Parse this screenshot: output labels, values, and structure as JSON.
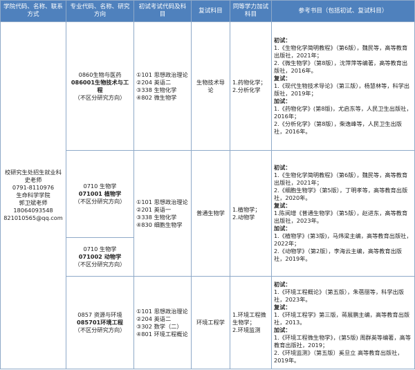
{
  "headers": [
    "学院代码、名称、联系方式",
    "专业代码、名称、研究方向",
    "初试考试代码及科目",
    "复试科目",
    "同等学力加试科目",
    "参考书目（包括初试、复试科目）"
  ],
  "contact": {
    "line1": "校研究生处招生就业科",
    "line2": "史老师",
    "line3": "0791-8110976",
    "line4": "生命科学学院",
    "line5": "郭卫斌老师",
    "line6": "18064093548",
    "line7": "821010565@qq.com"
  },
  "rows": [
    {
      "major_category": "0860生物与医药",
      "major_code_name": "086001生物技术与工程",
      "direction": "（不区分研究方向）",
      "exams": [
        "①101 思想政治理论",
        "②204 英语二",
        "③338 生物化学",
        "④802 微生物学"
      ],
      "retest": "生物技术导论",
      "equiv": [
        "1.药物化学；",
        "2.分析化学"
      ],
      "refs": [
        {
          "t": "h",
          "v": "初试："
        },
        {
          "t": "p",
          "v": "1.《生物化学简明教程》（第6版），魏民等，高等教育出版社，2021年；"
        },
        {
          "t": "p",
          "v": "2.《微生物学》（第8版），沈萍萍等编著，高等教育出版社，2016年。"
        },
        {
          "t": "h",
          "v": "复试："
        },
        {
          "t": "p",
          "v": "1.《现代生物技术导论》（第三版），杨慧林等，科学出版社，2019年；"
        },
        {
          "t": "h",
          "v": "加试："
        },
        {
          "t": "p",
          "v": "1.《药物化学》(第8版)，尤启东等，人民卫生出版社，2016年；"
        },
        {
          "t": "p",
          "v": "2.《分析化学》（第8版），柴逸峰等，人民卫生出版社，2016年。"
        }
      ]
    },
    {
      "major_category": "0710 生物学",
      "major_code_name": "071001 植物学",
      "direction": "（不区分研究方向）"
    },
    {
      "major_category": "0710 生物学",
      "major_code_name": "071002 动物学",
      "direction": "（不区分研究方向）"
    },
    {
      "major_category": "0857 资源与环境",
      "major_code_name": "085701环境工程",
      "direction": "（不区分研究方向）",
      "exams": [
        "①101 思想政治理论",
        "②204 英语二",
        "③302 数学（二）",
        "④801 环境工程概论"
      ],
      "retest": "环境工程学",
      "equiv": [
        "1.环境工程微生物学；",
        "2.环境监测"
      ],
      "refs": [
        {
          "t": "h",
          "v": "初试："
        },
        {
          "t": "p",
          "v": "1.《环境工程概论》（第五版），朱蓓丽等，科学出版社，2023年。"
        },
        {
          "t": "h",
          "v": "复试："
        },
        {
          "t": "p",
          "v": "1.《环境工程学》第三版，蒋展鹏主编，高等教育出版社，2013。"
        },
        {
          "t": "h",
          "v": "加试："
        },
        {
          "t": "p",
          "v": "1.《环境工程微生物学》，(第5版) 周群英等编著，高等教育出版社，2019；"
        },
        {
          "t": "p",
          "v": "2.《环境监测》（第五版）奚旦立 高等教育出版社，2019年。"
        }
      ]
    }
  ],
  "bio_group": {
    "exams": [
      "①101 思想政治理论",
      "②201 英语一",
      "③338 生物化学",
      "④830 细胞生物学"
    ],
    "retest": "普通生物学",
    "equiv": [
      "1.植物学；",
      "2.动物学"
    ],
    "refs": [
      {
        "t": "h",
        "v": "初试："
      },
      {
        "t": "p",
        "v": "1.《生物化学简明教程》（第6版），魏民等，高等教育出版社，2021年；"
      },
      {
        "t": "p",
        "v": "2.《细胞生物学》（第5版），丁明孝等，高等教育出版社，2020年。"
      },
      {
        "t": "h",
        "v": "复试："
      },
      {
        "t": "p",
        "v": "1.陈阅增《普通生物学》（第5版），赵进东，高等教育出版社，2023年。"
      },
      {
        "t": "h",
        "v": "加试："
      },
      {
        "t": "p",
        "v": "1.《植物学》(第3版)，马炜梁主编，高等教育出版社，2022年；"
      },
      {
        "t": "p",
        "v": "2.《动物学》（第2版），李海云主编，高等教育出版社，2019年。"
      }
    ]
  }
}
